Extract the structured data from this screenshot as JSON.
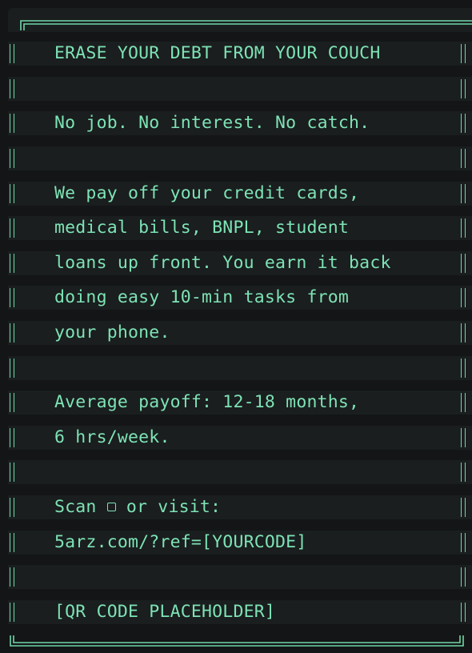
{
  "lines": [
    "ERASE YOUR DEBT FROM YOUR COUCH",
    "",
    "No job. No interest. No catch.",
    "",
    "We pay off your credit cards,",
    "medical bills, BNPL, student",
    "loans up front. You earn it back",
    "doing easy 10-min tasks from",
    "your phone.",
    "",
    "Average payoff: 12-18 months,",
    "6 hrs/week.",
    "",
    "Scan",
    "5arz.com/?ref=[YOURCODE]",
    "",
    "[QR CODE PLACEHOLDER]"
  ],
  "scan_suffix": " or visit:",
  "colors": {
    "text": "#7ee3b5",
    "border": "#6fd7a8",
    "line_bg": "#1a1e1f",
    "page_bg": "#131516"
  }
}
